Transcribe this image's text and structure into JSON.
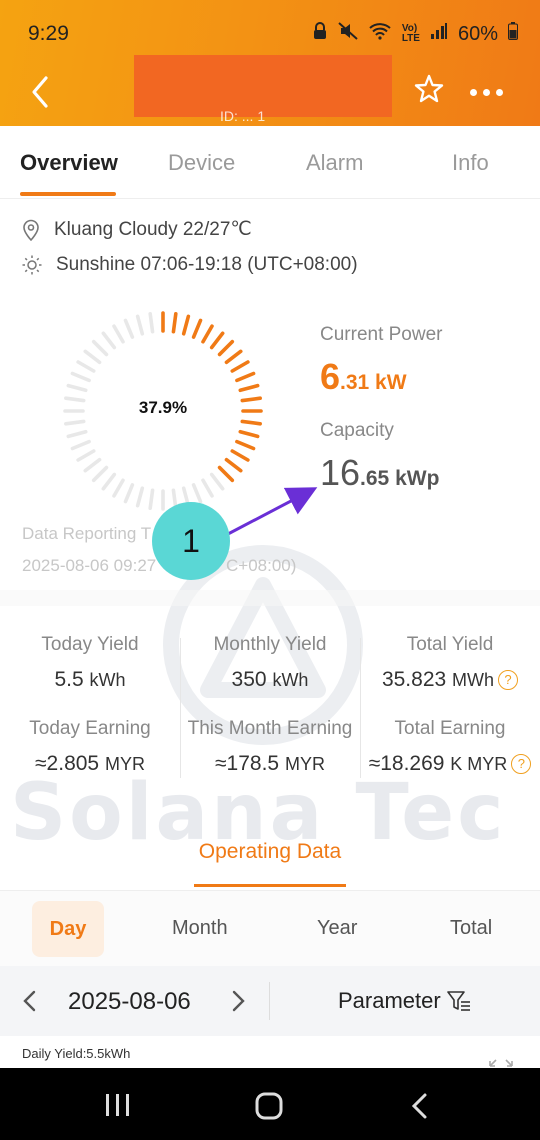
{
  "status": {
    "time": "9:29",
    "battery": "60%"
  },
  "header": {
    "subtitle": "ID: ... 1"
  },
  "tabs": [
    {
      "label": "Overview"
    },
    {
      "label": "Device"
    },
    {
      "label": "Alarm"
    },
    {
      "label": "Info"
    }
  ],
  "weather": {
    "location": "Kluang Cloudy 22/27℃",
    "sunshine": "Sunshine 07:06-19:18 (UTC+08:00)"
  },
  "gauge": {
    "percent_label": "37.9%",
    "value_fraction": 0.379
  },
  "power": {
    "current_label": "Current Power",
    "current_int": "6",
    "current_dec": ".31 kW",
    "capacity_label": "Capacity",
    "capacity_int": "16",
    "capacity_dec": ".65 kWp"
  },
  "reporting": {
    "label": "Data Reporting T",
    "time": "2025-08-06 09:27",
    "tz": "C+08:00)"
  },
  "stats": {
    "today_yield": {
      "title": "Today Yield",
      "value": "5.5",
      "unit": "kWh"
    },
    "monthly_yield": {
      "title": "Monthly Yield",
      "value": "350",
      "unit": "kWh"
    },
    "total_yield": {
      "title": "Total Yield",
      "value": "35.823",
      "unit": "MWh"
    },
    "today_earning": {
      "title": "Today Earning",
      "value": "≈2.805",
      "unit": "MYR"
    },
    "month_earning": {
      "title": "This Month Earning",
      "value": "≈178.5",
      "unit": "MYR"
    },
    "total_earning": {
      "title": "Total Earning",
      "value": "≈18.269",
      "unit": "K MYR"
    }
  },
  "watermark": "Solana Tec",
  "operating": {
    "title": "Operating Data"
  },
  "periods": [
    {
      "label": "Day"
    },
    {
      "label": "Month"
    },
    {
      "label": "Year"
    },
    {
      "label": "Total"
    }
  ],
  "date_bar": {
    "date": "2025-08-06",
    "parameter": "Parameter"
  },
  "daily_yield": "Daily Yield:5.5kWh",
  "annotation": {
    "badge": "1"
  },
  "colors": {
    "accent": "#f07a16",
    "header_start": "#f5a311",
    "badge": "#5ad7d5",
    "arrow": "#6a2fd6"
  }
}
